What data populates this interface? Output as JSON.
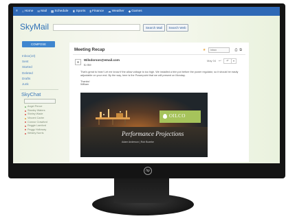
{
  "nav": {
    "items": [
      {
        "icon": "home-icon",
        "glyph": "⌂",
        "label": "Home"
      },
      {
        "icon": "mail-icon",
        "glyph": "✉",
        "label": "Mail"
      },
      {
        "icon": "calendar-icon",
        "glyph": "▦",
        "label": "Schedule"
      },
      {
        "icon": "trophy-icon",
        "glyph": "♜",
        "label": "Sports"
      },
      {
        "icon": "money-icon",
        "glyph": "$",
        "label": "Finance"
      },
      {
        "icon": "cloud-icon",
        "glyph": "☁",
        "label": "Weather"
      },
      {
        "icon": "gamepad-icon",
        "glyph": "◆",
        "label": "Games"
      }
    ],
    "menu_glyph": "≡"
  },
  "app": {
    "logo": "SkyMail"
  },
  "search": {
    "mail_button": "Search Mail",
    "web_button": "Search Web"
  },
  "sidebar": {
    "compose": "COMPOSE",
    "folders": [
      "Inbox(10)",
      "Sent",
      "Started",
      "Deleted",
      "Drafts",
      "Junk"
    ],
    "chat_title": "SkyChat",
    "contacts": [
      {
        "name": "Angel Pence",
        "color": "#6fb36a"
      },
      {
        "name": "Stanley Waters",
        "color": "#d9534f"
      },
      {
        "name": "Shirley Wade",
        "color": "#d9534f"
      },
      {
        "name": "Vincent Carter",
        "color": "#e0a040"
      },
      {
        "name": "Connor Crawford",
        "color": "#d9534f"
      },
      {
        "name": "Reggie Lamford",
        "color": "#d9534f"
      },
      {
        "name": "Peggy Holloway",
        "color": "#d9534f"
      },
      {
        "name": "Wesley Norris",
        "color": "#d9534f"
      }
    ]
  },
  "message": {
    "subject": "Meeting Recap",
    "move_select": "Inbox",
    "sender": "Wilsdorson@email.com",
    "to": "to me",
    "date": "May 04",
    "avatar_glyph": "✉",
    "body": "That's great to hear! Let me know if the allow voltage is too high. We installed a trim pot before the power regulator, so it should be easily adjustable on your end. By the way, here is the Powerpoint that we will present on Monday.",
    "signoff": "Thanks!",
    "signature": "William",
    "slide": {
      "brand": "OILCO",
      "title": "Performance Projections",
      "presenters": "Adam Anderson  |  Rob Bozeke"
    }
  },
  "device": {
    "brand": "hp"
  }
}
